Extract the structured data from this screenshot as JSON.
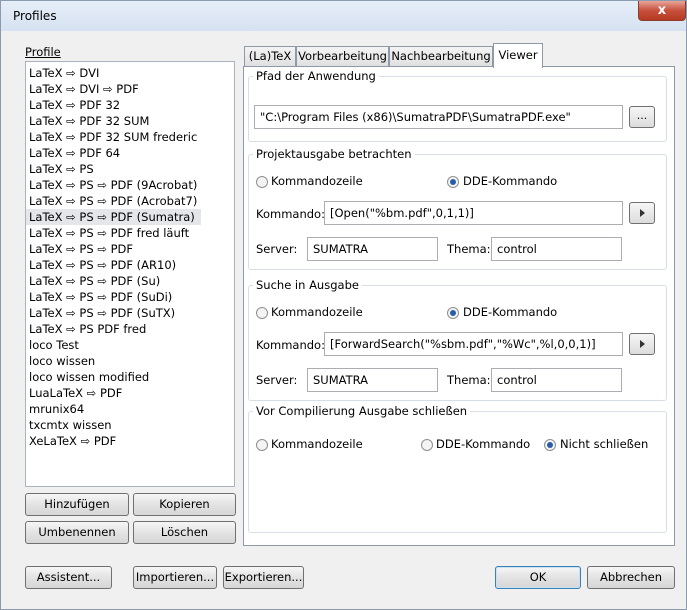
{
  "window": {
    "title": "Profiles",
    "close_glyph": "x"
  },
  "profiles": {
    "label": "Profile",
    "items": [
      "LaTeX ⇨ DVI",
      "LaTeX ⇨ DVI ⇨ PDF",
      "LaTeX ⇨ PDF 32",
      "LaTeX ⇨ PDF 32 SUM",
      "LaTeX ⇨ PDF 32 SUM frederic",
      "LaTeX ⇨ PDF 64",
      "LaTeX ⇨ PS",
      "LaTeX ⇨ PS ⇨ PDF (9Acrobat)",
      "LaTeX ⇨ PS ⇨ PDF (Acrobat7)",
      "LaTeX ⇨ PS ⇨ PDF (Sumatra)",
      "LaTeX ⇨ PS ⇨ PDF fred läuft",
      "LaTeX ⇨ PS ⇨ PDF",
      "LaTeX ⇨ PS ⇨ PDF (AR10)",
      "LaTeX ⇨ PS ⇨ PDF (Su)",
      "LaTeX ⇨ PS ⇨ PDF (SuDi)",
      "LaTeX ⇨ PS ⇨ PDF (SuTX)",
      "LaTeX ⇨ PS PDF fred",
      "loco Test",
      "loco wissen",
      "loco wissen modified",
      "LuaLaTeX ⇨ PDF",
      "mrunix64",
      "txcmtx wissen",
      "XeLaTeX ⇨ PDF"
    ],
    "selected_index": 9,
    "buttons": {
      "add": "Hinzufügen",
      "copy": "Kopieren",
      "rename": "Umbenennen",
      "delete": "Löschen"
    }
  },
  "tabs": [
    "(La)TeX",
    "Vorbearbeitung",
    "Nachbearbeitung",
    "Viewer"
  ],
  "active_tab": "Viewer",
  "viewer": {
    "app_path": {
      "title": "Pfad der Anwendung",
      "value": "\"C:\\Program Files (x86)\\SumatraPDF\\SumatraPDF.exe\"",
      "browse_label": "..."
    },
    "project_output": {
      "title": "Projektausgabe betrachten",
      "radio_cmdline": "Kommandozeile",
      "radio_dde": "DDE-Kommando",
      "selected": "DDE-Kommando",
      "command_label": "Kommando:",
      "command_value": "[Open(\"%bm.pdf\",0,1,1)]",
      "server_label": "Server:",
      "server_value": "SUMATRA",
      "topic_label": "Thema:",
      "topic_value": "control"
    },
    "search_output": {
      "title": "Suche in Ausgabe",
      "radio_cmdline": "Kommandozeile",
      "radio_dde": "DDE-Kommando",
      "selected": "DDE-Kommando",
      "command_label": "Kommando:",
      "command_value": "[ForwardSearch(\"%sbm.pdf\",\"%Wc\",%l,0,0,1)]",
      "server_label": "Server:",
      "server_value": "SUMATRA",
      "topic_label": "Thema:",
      "topic_value": "control"
    },
    "close_before_compile": {
      "title": "Vor Compilierung Ausgabe schließen",
      "radio_cmdline": "Kommandozeile",
      "radio_dde": "DDE-Kommando",
      "radio_none": "Nicht schließen",
      "selected": "Nicht schließen"
    }
  },
  "footer": {
    "wizard": "Assistent...",
    "import": "Importieren...",
    "export": "Exportieren...",
    "ok": "OK",
    "cancel": "Abbrechen"
  }
}
